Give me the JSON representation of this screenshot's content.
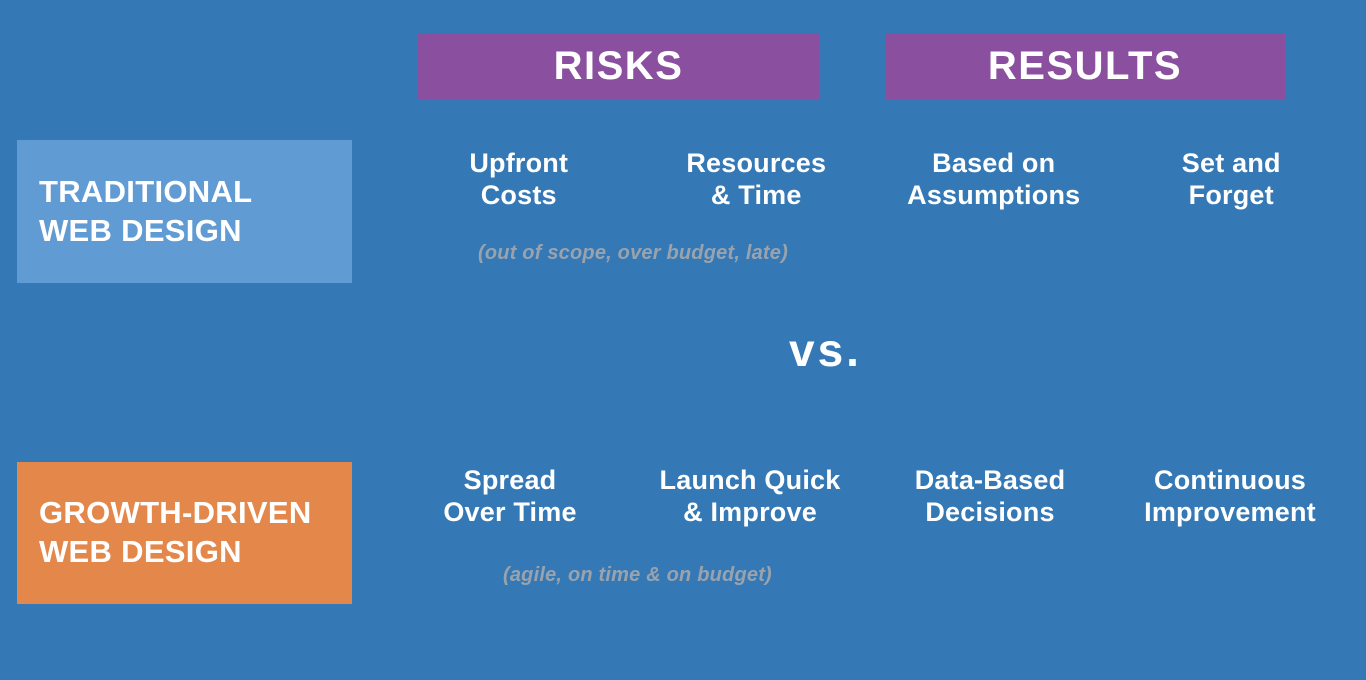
{
  "slide": {
    "background_color": "#3479b5",
    "vs_label": "vs."
  },
  "column_headers": [
    {
      "label": "RISKS",
      "color": "#8b4f9f"
    },
    {
      "label": "RESULTS",
      "color": "#8b4f9f"
    }
  ],
  "rows": [
    {
      "label_line1": "TRADITIONAL",
      "label_line2": "WEB DESIGN",
      "box_color": "#619bd3",
      "cells": [
        {
          "line1": "Upfront",
          "line2": "Costs"
        },
        {
          "line1": "Resources",
          "line2": "& Time"
        },
        {
          "line1": "Based on",
          "line2": "Assumptions"
        },
        {
          "line1": "Set and",
          "line2": "Forget"
        }
      ],
      "note": "(out of scope, over budget, late)",
      "note_color": "#9aa3ad"
    },
    {
      "label_line1": "GROWTH-DRIVEN",
      "label_line2": "WEB DESIGN",
      "box_color": "#e3884a",
      "cells": [
        {
          "line1": "Spread",
          "line2": "Over Time"
        },
        {
          "line1": "Launch Quick",
          "line2": "& Improve"
        },
        {
          "line1": "Data-Based",
          "line2": "Decisions"
        },
        {
          "line1": "Continuous",
          "line2": "Improvement"
        }
      ],
      "note": "(agile, on time & on budget)",
      "note_color": "#9aa3ad"
    }
  ]
}
